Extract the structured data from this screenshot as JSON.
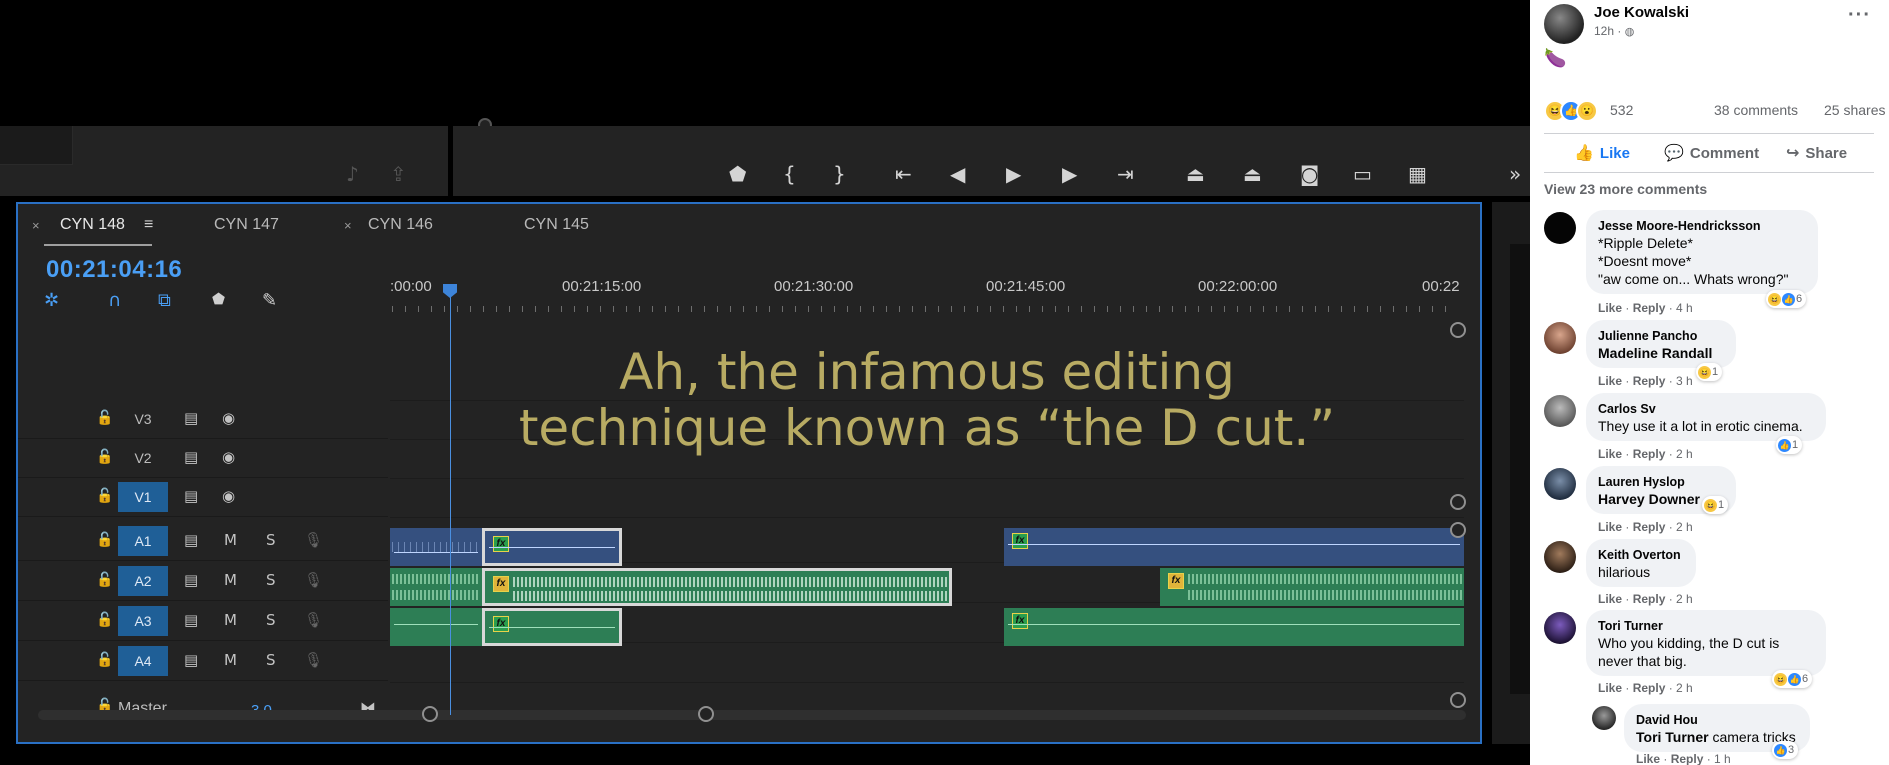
{
  "premiere": {
    "program_controls": [
      "marker-icon",
      "mark-in-icon",
      "mark-out-icon",
      "go-to-in-icon",
      "step-back-icon",
      "play-icon",
      "step-forward-icon",
      "go-to-out-icon",
      "lift-icon",
      "extract-icon",
      "export-frame-icon",
      "comparison-view-icon",
      "multi-camera-icon",
      "more-icon"
    ],
    "tabs": [
      {
        "label": "CYN 148",
        "active": true,
        "close": "×",
        "menu": "≡"
      },
      {
        "label": "CYN 147",
        "active": false
      },
      {
        "label": "CYN 146",
        "active": false,
        "close": "×"
      },
      {
        "label": "CYN 145",
        "active": false
      }
    ],
    "timecode": "00:21:04:16",
    "ruler_labels": [
      ":00:00",
      "00:21:15:00",
      "00:21:30:00",
      "00:21:45:00",
      "00:22:00:00",
      "00:22"
    ],
    "video_tracks": [
      {
        "name": "V3",
        "targeted": false
      },
      {
        "name": "V2",
        "targeted": false
      },
      {
        "name": "V1",
        "targeted": true
      }
    ],
    "audio_tracks": [
      {
        "name": "A1",
        "targeted": true,
        "m": "M",
        "s": "S"
      },
      {
        "name": "A2",
        "targeted": true,
        "m": "M",
        "s": "S"
      },
      {
        "name": "A3",
        "targeted": true,
        "m": "M",
        "s": "S"
      },
      {
        "name": "A4",
        "targeted": true,
        "m": "M",
        "s": "S"
      }
    ],
    "master": {
      "label": "Master",
      "value": "-3.0"
    },
    "caption_line1": "Ah, the infamous editing",
    "caption_line2": "technique known as “the D cut.”",
    "colors": {
      "accent": "#4a9ff5",
      "panel": "#232323",
      "audio_green": "#2d7e55",
      "audio_blue": "#35507f",
      "caption": "#b8ab63"
    }
  },
  "post": {
    "author": "Joe Kowalski",
    "time": "12h · ",
    "privacy_icon": "globe-icon",
    "content_emoji": "🍆",
    "reaction_count": "532",
    "comments_count": "38 comments",
    "shares_count": "25 shares",
    "actions": {
      "like": "Like",
      "comment": "Comment",
      "share": "Share"
    },
    "view_more": "View 23 more comments"
  },
  "comments": [
    {
      "name": "Jesse Moore-Hendricksson",
      "lines": [
        "*Ripple Delete*",
        "*Doesnt move*",
        "\"aw come on... Whats wrong?\""
      ],
      "like": "Like",
      "reply": "Reply",
      "time": "4 h",
      "reactions": "6"
    },
    {
      "name": "Julienne Pancho",
      "tag": "Madeline Randall",
      "text": "",
      "like": "Like",
      "reply": "Reply",
      "time": "3 h",
      "reactions": "1"
    },
    {
      "name": "Carlos Sv",
      "text": "They use it a lot in erotic cinema.",
      "like": "Like",
      "reply": "Reply",
      "time": "2 h",
      "reactions": "1"
    },
    {
      "name": "Lauren Hyslop",
      "tag": "Harvey Downer",
      "text": "",
      "like": "Like",
      "reply": "Reply",
      "time": "2 h",
      "reactions": "1"
    },
    {
      "name": "Keith Overton",
      "text": "hilarious",
      "like": "Like",
      "reply": "Reply",
      "time": "2 h"
    },
    {
      "name": "Tori Turner",
      "text": "Who you kidding, the D cut is never that big.",
      "like": "Like",
      "reply": "Reply",
      "time": "2 h",
      "reactions": "6"
    },
    {
      "name": "David Hou",
      "tag": "Tori Turner",
      "text": " camera tricks",
      "like": "Like",
      "reply": "Reply",
      "time": "1 h",
      "reactions": "3"
    }
  ]
}
